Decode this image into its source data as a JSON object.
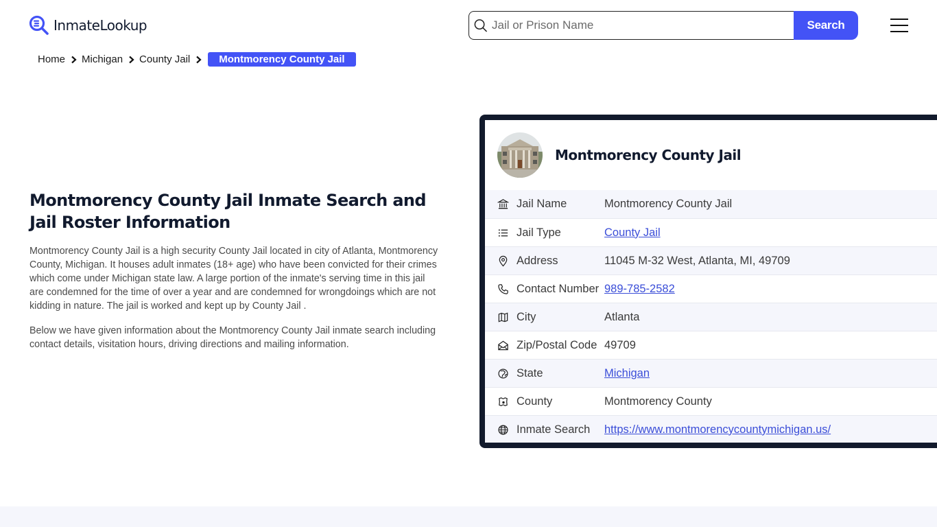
{
  "header": {
    "logo_text": "InmateLookup",
    "search_placeholder": "Jail or Prison Name",
    "search_button": "Search",
    "brand_color": "#4353f6"
  },
  "breadcrumb": {
    "items": [
      "Home",
      "Michigan",
      "County Jail"
    ],
    "current": "Montmorency County Jail"
  },
  "intro": {
    "title": "Montmorency County Jail Inmate Search and Jail Roster Information",
    "paragraph1": "Montmorency County Jail is a high security County Jail located in city of Atlanta, Montmorency County, Michigan. It houses adult inmates (18+ age) who have been convicted for their crimes which come under Michigan state law. A large portion of the inmate's serving time in this jail are condemned for the time of over a year and are condemned for wrongdoings which are not kidding in nature. The jail is worked and kept up by County Jail .",
    "paragraph2": "Below we have given information about the Montmorency County Jail inmate search including contact details, visitation hours, driving directions and mailing information."
  },
  "card": {
    "title": "Montmorency County Jail",
    "rows": [
      {
        "icon": "bank-icon",
        "label": "Jail Name",
        "value": "Montmorency County Jail",
        "link": false
      },
      {
        "icon": "list-icon",
        "label": "Jail Type",
        "value": "County Jail",
        "link": true
      },
      {
        "icon": "map-pin-icon",
        "label": "Address",
        "value": "11045 M-32 West, Atlanta, MI, 49709",
        "link": false
      },
      {
        "icon": "phone-icon",
        "label": "Contact Number",
        "value": "989-785-2582",
        "link": true
      },
      {
        "icon": "map-icon",
        "label": "City",
        "value": "Atlanta",
        "link": false
      },
      {
        "icon": "mail-open-icon",
        "label": "Zip/Postal Code",
        "value": "49709",
        "link": false
      },
      {
        "icon": "globe-region-icon",
        "label": "State",
        "value": "Michigan",
        "link": true
      },
      {
        "icon": "map-marker-icon",
        "label": "County",
        "value": "Montmorency County",
        "link": false
      },
      {
        "icon": "globe-icon",
        "label": "Inmate Search",
        "value": "https://www.montmorencycountymichigan.us/",
        "link": true
      }
    ]
  }
}
